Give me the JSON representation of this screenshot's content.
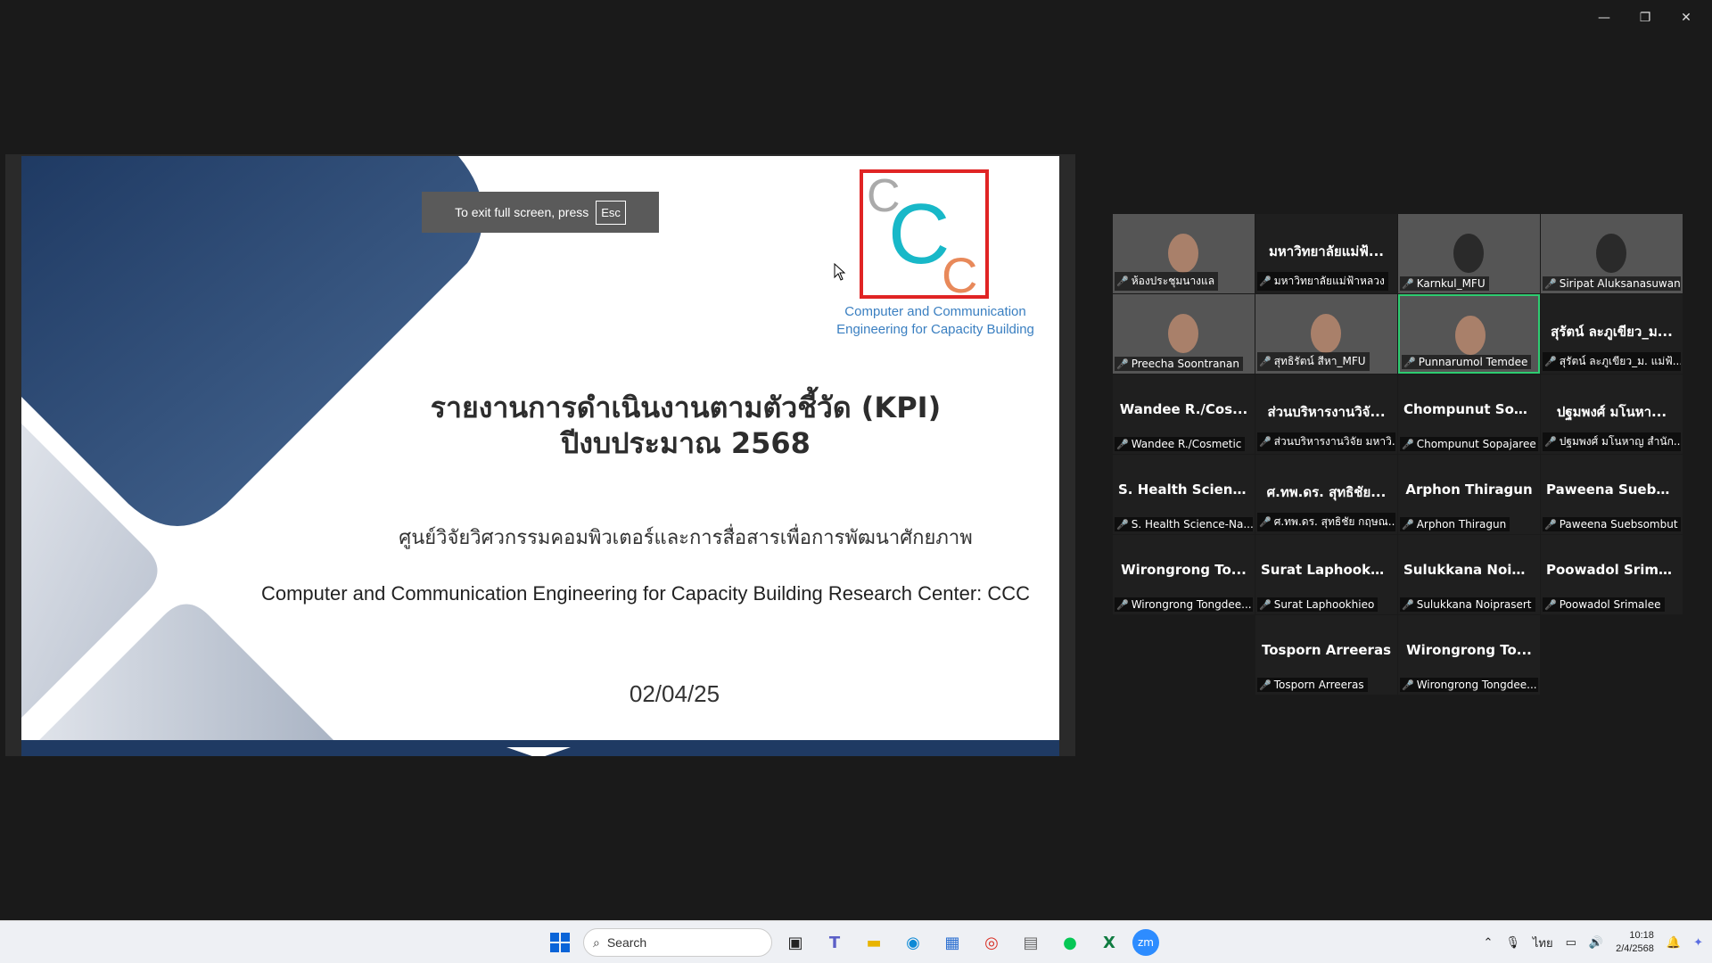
{
  "window_controls": {
    "minimize": "—",
    "restore": "❐",
    "close": "✕"
  },
  "fullscreen_toast": {
    "text": "To exit full screen, press",
    "key": "Esc"
  },
  "slide": {
    "logo_letters": [
      "C",
      "C",
      "C"
    ],
    "logo_caption_line1": "Computer and Communication",
    "logo_caption_line2": "Engineering for Capacity Building",
    "title_line1": "รายงานการดำเนินงานตามตัวชี้วัด (KPI)",
    "title_line2": "ปีงบประมาณ 2568",
    "subtitle_th": "ศูนย์วิจัยวิศวกรรมคอมพิวเตอร์และการสื่อสารเพื่อการพัฒนาศักยภาพ",
    "subtitle_en": "Computer and Communication Engineering for Capacity Building Research  Center: CCC",
    "date": "02/04/25",
    "colors": {
      "shape_dark": "#1f3a63",
      "shape_light": "#c8cdd8",
      "logo_border": "#e02424",
      "logo_c": "#18b8c8"
    }
  },
  "participants": [
    {
      "big": "",
      "label": "ห้องประชุมนางแล",
      "video": "vid-room"
    },
    {
      "big": "มหาวิทยาลัยแม่ฟ้...",
      "label": "มหาวิทยาลัยแม่ฟ้าหลวง",
      "video": ""
    },
    {
      "big": "",
      "label": "Karnkul_MFU",
      "video": "vid-p1"
    },
    {
      "big": "",
      "label": "Siripat Aluksanasuwan",
      "video": "vid-p2"
    },
    {
      "big": "",
      "label": "Preecha Soontranan",
      "video": "vid-p3"
    },
    {
      "big": "",
      "label": "สุทธิรัตน์ สีหา_MFU",
      "video": "vid-p4"
    },
    {
      "big": "",
      "label": "Punnarumol Temdee",
      "video": "vid-p5",
      "talking": true
    },
    {
      "big": "สุรัตน์ ละภูเขียว_ม...",
      "label": "สุรัตน์ ละภูเขียว_ม. แม่ฟ้...",
      "video": ""
    },
    {
      "big": "Wandee R./Cos...",
      "label": "Wandee R./Cosmetic",
      "video": ""
    },
    {
      "big": "ส่วนบริหารงานวิจั...",
      "label": "ส่วนบริหารงานวิจัย มหาวิ...",
      "video": ""
    },
    {
      "big": "Chompunut Sop...",
      "label": "Chompunut Sopajaree",
      "video": ""
    },
    {
      "big": "ปฐมพงศ์ มโนหา...",
      "label": "ปฐมพงศ์ มโนหาญ สำนัก...",
      "video": ""
    },
    {
      "big": "S. Health Scienc...",
      "label": "S. Health Science-Na...",
      "video": ""
    },
    {
      "big": "ศ.ทพ.ดร. สุทธิชัย...",
      "label": "ศ.ทพ.ดร. สุทธิชัย กฤษณ...",
      "video": ""
    },
    {
      "big": "Arphon Thiragun",
      "label": "Arphon Thiragun",
      "video": ""
    },
    {
      "big": "Paweena Suebs...",
      "label": "Paweena Suebsombut",
      "video": ""
    },
    {
      "big": "Wirongrong To...",
      "label": "Wirongrong Tongdee...",
      "video": ""
    },
    {
      "big": "Surat Laphookhi...",
      "label": "Surat Laphookhieo",
      "video": ""
    },
    {
      "big": "Sulukkana Noip...",
      "label": "Sulukkana Noiprasert",
      "video": ""
    },
    {
      "big": "Poowadol Srima...",
      "label": "Poowadol Srimalee",
      "video": ""
    },
    {
      "big": "Tosporn Arreeras",
      "label": "Tosporn Arreeras",
      "video": ""
    },
    {
      "big": "Wirongrong To...",
      "label": "Wirongrong Tongdee...",
      "video": ""
    }
  ],
  "taskbar": {
    "search_placeholder": "Search",
    "language": "ไทย",
    "time": "10:18",
    "date": "2/4/2568"
  }
}
